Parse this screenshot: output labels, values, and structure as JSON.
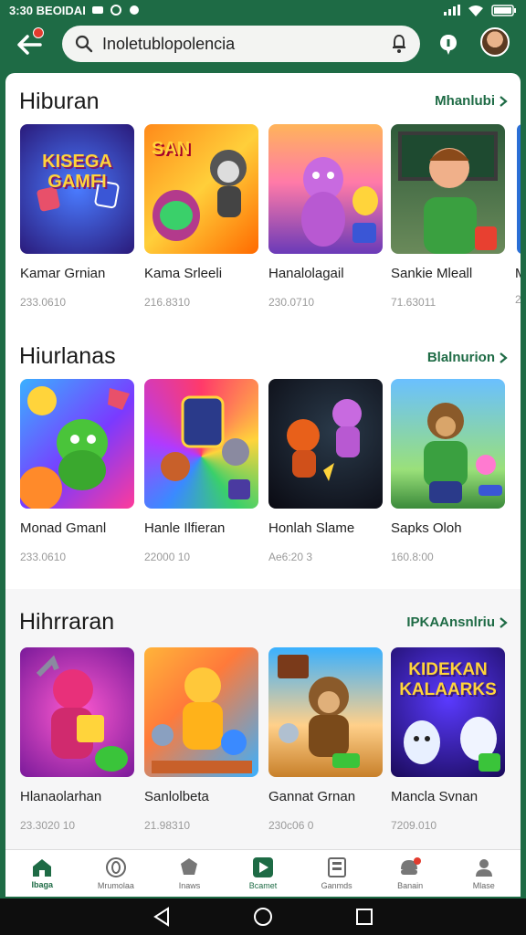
{
  "status_bar": {
    "time_text": "3:30 BEOIDAI"
  },
  "search": {
    "value": "Inoletublopolencia"
  },
  "sections": [
    {
      "title": "Hiburan",
      "more_label": "Mhanlubi",
      "items": [
        {
          "name": "Kamar Grnian",
          "meta": "233.0610",
          "thumb_caption": "KISEGA GAMFI"
        },
        {
          "name": "Kama Srleeli",
          "meta": "216.8310",
          "thumb_caption": "SAN"
        },
        {
          "name": "Hanalolagail",
          "meta": "230.0710",
          "thumb_caption": ""
        },
        {
          "name": "Sankie Mleall",
          "meta": "71.63011",
          "thumb_caption": ""
        },
        {
          "name": "M",
          "meta": "2",
          "thumb_caption": ""
        }
      ]
    },
    {
      "title": "Hiurlanas",
      "more_label": "Blalnurion",
      "items": [
        {
          "name": "Monad Gmanl",
          "meta": "233.0610",
          "thumb_caption": ""
        },
        {
          "name": "Hanle Ilfieran",
          "meta": "22000 10",
          "thumb_caption": ""
        },
        {
          "name": "Honlah Slame",
          "meta": "Ae6:20 3",
          "thumb_caption": ""
        },
        {
          "name": "Sapks Oloh",
          "meta": "160.8:00",
          "thumb_caption": ""
        }
      ]
    },
    {
      "title": "Hihrraran",
      "more_label": "IPKAAnsnlriu",
      "items": [
        {
          "name": "Hlanaolarhan",
          "meta": "23.3020 10",
          "thumb_caption": ""
        },
        {
          "name": "Sanlolbeta",
          "meta": "21.98310",
          "thumb_caption": ""
        },
        {
          "name": "Gannat Grnan",
          "meta": "230c06 0",
          "thumb_caption": ""
        },
        {
          "name": "Mancla Svnan",
          "meta": "7209.010",
          "thumb_caption": "KIDEKAN KALAARKS"
        }
      ]
    }
  ],
  "bottom_nav": [
    {
      "label": "Ibaga",
      "icon": "home-icon",
      "active": true
    },
    {
      "label": "Mrumolaa",
      "icon": "circle-icon",
      "active": false
    },
    {
      "label": "Inaws",
      "icon": "shield-icon",
      "active": false
    },
    {
      "label": "Bcamet",
      "icon": "play-store-icon",
      "active": false
    },
    {
      "label": "Ganmds",
      "icon": "list-icon",
      "active": false
    },
    {
      "label": "Banain",
      "icon": "notification-icon",
      "active": false
    },
    {
      "label": "Mlase",
      "icon": "person-icon",
      "active": false
    }
  ],
  "colors": {
    "brand": "#1e6b45",
    "badge": "#e23b2e"
  }
}
